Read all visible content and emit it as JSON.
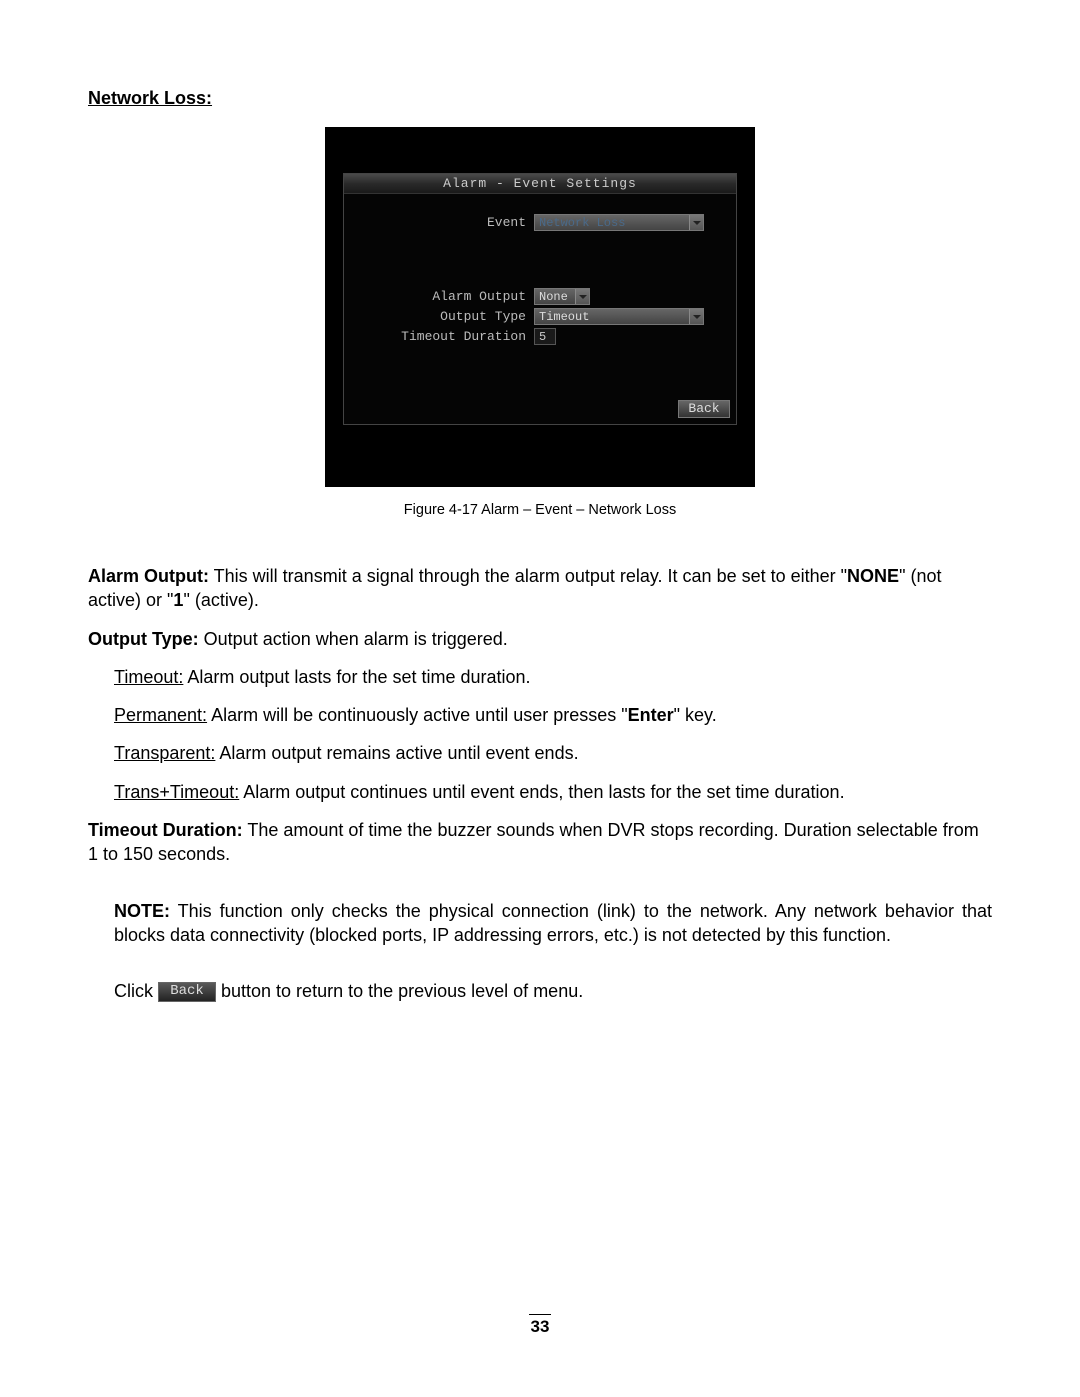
{
  "section_title": "Network Loss:",
  "dvr": {
    "title": "Alarm - Event Settings",
    "rows": {
      "event": {
        "label": "Event",
        "value": "Network Loss"
      },
      "alarm_output": {
        "label": "Alarm Output",
        "value": "None"
      },
      "output_type": {
        "label": "Output Type",
        "value": "Timeout"
      },
      "timeout_duration": {
        "label": "Timeout Duration",
        "value": "5"
      }
    },
    "back_label": "Back"
  },
  "figure_caption": "Figure 4-17 Alarm – Event – Network Loss",
  "paragraphs": {
    "alarm_output": {
      "label": "Alarm Output:",
      "text_a": " This will transmit a signal through the alarm output relay. It can be set to either \"",
      "none": "NONE",
      "text_b": "\" (not active) or \"",
      "one": "1",
      "text_c": "\" (active)."
    },
    "output_type": {
      "label": "Output Type:",
      "text": " Output action when alarm is triggered."
    },
    "timeout": {
      "label": "Timeout:",
      "text": " Alarm output lasts for the set time duration."
    },
    "permanent": {
      "label": "Permanent:",
      "text_a": " Alarm will be continuously active until user presses \"",
      "enter": "Enter",
      "text_b": "\" key."
    },
    "transparent": {
      "label": "Transparent:",
      "text": " Alarm output remains active until event ends."
    },
    "trans_timeout": {
      "label": "Trans+Timeout:",
      "text": " Alarm output continues until event ends, then lasts for the set time duration."
    },
    "timeout_duration": {
      "label": "Timeout Duration:",
      "text": " The amount of time the buzzer sounds when DVR stops recording. Duration selectable from 1 to 150 seconds."
    },
    "note": {
      "label": "NOTE:",
      "text": " This function only checks the physical connection (link) to the network. Any network behavior that blocks data connectivity (blocked ports, IP addressing errors, etc.) is not detected by this function."
    },
    "click": {
      "text_a": "Click ",
      "back": "Back",
      "text_b": " button to return to the previous level of menu."
    }
  },
  "page_number": "33"
}
